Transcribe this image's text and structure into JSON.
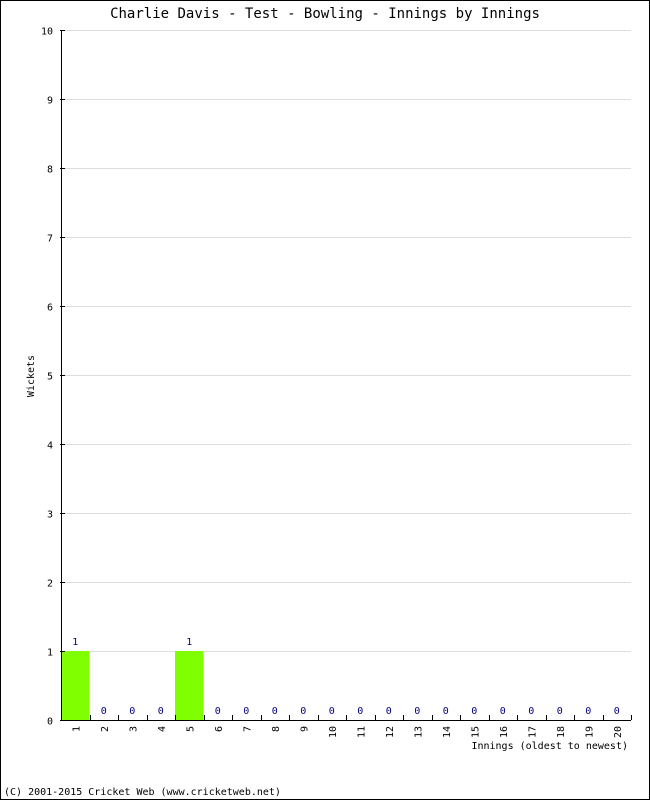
{
  "chart_data": {
    "type": "bar",
    "title": "Charlie Davis - Test - Bowling - Innings by Innings",
    "xlabel": "Innings (oldest to newest)",
    "ylabel": "Wickets",
    "ylim": [
      0,
      10
    ],
    "yticks": [
      0,
      1,
      2,
      3,
      4,
      5,
      6,
      7,
      8,
      9,
      10
    ],
    "grid": true,
    "categories": [
      "1",
      "2",
      "3",
      "4",
      "5",
      "6",
      "7",
      "8",
      "9",
      "10",
      "11",
      "12",
      "13",
      "14",
      "15",
      "16",
      "17",
      "18",
      "19",
      "20"
    ],
    "values": [
      1,
      0,
      0,
      0,
      1,
      0,
      0,
      0,
      0,
      0,
      0,
      0,
      0,
      0,
      0,
      0,
      0,
      0,
      0,
      0
    ],
    "bar_color": "#80FF00",
    "label_color": "#000080",
    "grid_color": "#DDDDDD"
  },
  "footer": "(C) 2001-2015 Cricket Web (www.cricketweb.net)"
}
